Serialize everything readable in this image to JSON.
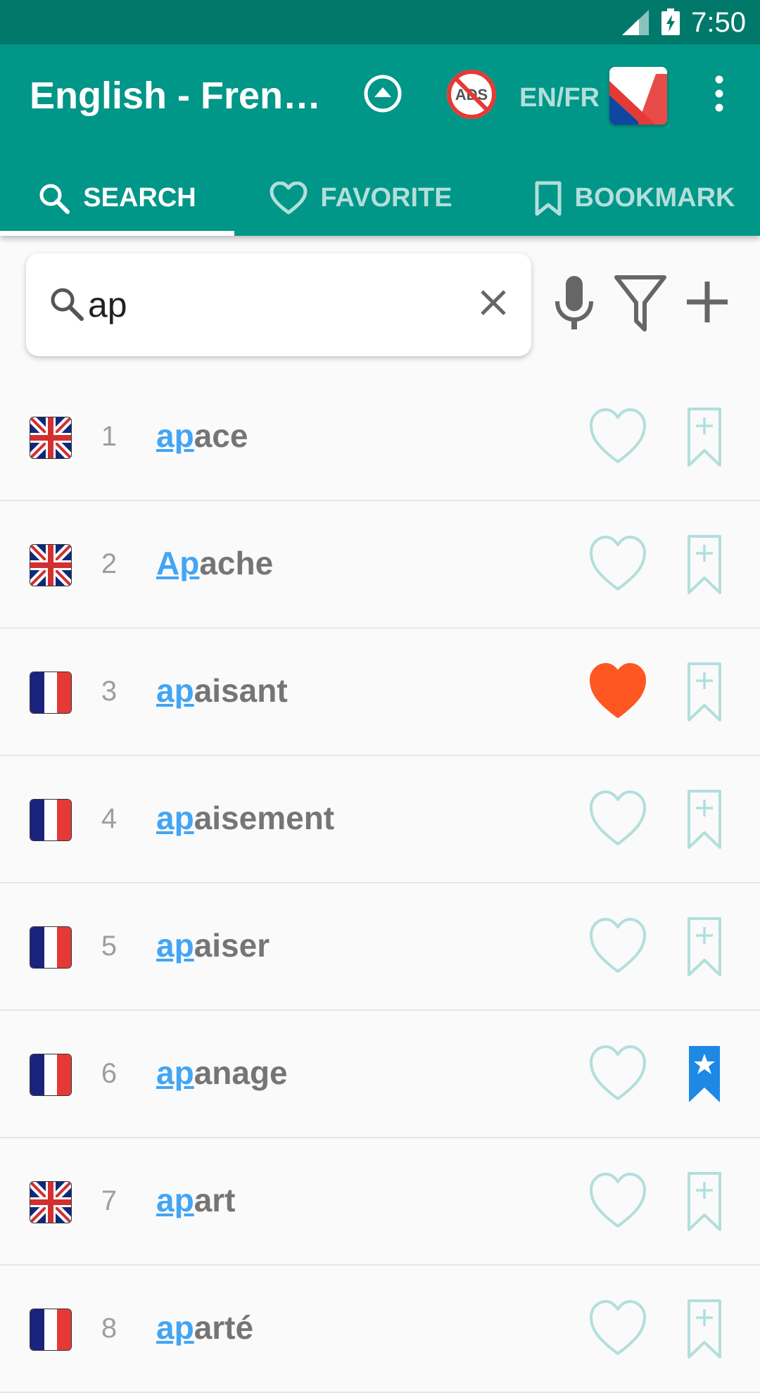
{
  "status_bar": {
    "time": "7:50",
    "icons": [
      "signal-icon",
      "battery-charging-icon"
    ]
  },
  "app_bar": {
    "title": "English - French…",
    "language_pair": "EN/FR",
    "actions": [
      "scroll-up-icon",
      "remove-ads-icon",
      "language-flag",
      "more-vert-icon"
    ]
  },
  "tabs": [
    {
      "label": "SEARCH",
      "icon": "search-icon",
      "active": true
    },
    {
      "label": "FAVORITE",
      "icon": "heart-outline-icon",
      "active": false
    },
    {
      "label": "BOOKMARK",
      "icon": "bookmark-outline-icon",
      "active": false
    }
  ],
  "search": {
    "query": "ap",
    "actions": [
      "microphone-icon",
      "filter-icon",
      "add-icon"
    ]
  },
  "results": [
    {
      "num": "1",
      "prefix": "ap",
      "rest": "ace",
      "lang": "en",
      "favorite": false,
      "bookmarked": false
    },
    {
      "num": "2",
      "prefix": "Ap",
      "rest": "ache",
      "lang": "en",
      "favorite": false,
      "bookmarked": false
    },
    {
      "num": "3",
      "prefix": "ap",
      "rest": "aisant",
      "lang": "fr",
      "favorite": true,
      "bookmarked": false
    },
    {
      "num": "4",
      "prefix": "ap",
      "rest": "aisement",
      "lang": "fr",
      "favorite": false,
      "bookmarked": false
    },
    {
      "num": "5",
      "prefix": "ap",
      "rest": "aiser",
      "lang": "fr",
      "favorite": false,
      "bookmarked": false
    },
    {
      "num": "6",
      "prefix": "ap",
      "rest": "anage",
      "lang": "fr",
      "favorite": false,
      "bookmarked": true
    },
    {
      "num": "7",
      "prefix": "ap",
      "rest": "art",
      "lang": "en",
      "favorite": false,
      "bookmarked": false
    },
    {
      "num": "8",
      "prefix": "ap",
      "rest": "arté",
      "lang": "fr",
      "favorite": false,
      "bookmarked": false
    }
  ],
  "colors": {
    "primary": "#009688",
    "status_bar": "#00796b",
    "highlight": "#42a5f5",
    "favorite_on": "#ff5722",
    "bookmark_on": "#1e88e5",
    "icon_outline": "#b2dfdb"
  }
}
